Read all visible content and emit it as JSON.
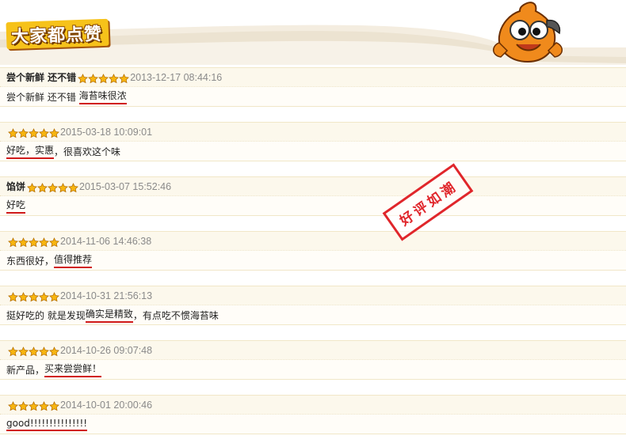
{
  "header": {
    "title": "大家都点赞",
    "mascot_icon": "orange-fish-mascot-icon"
  },
  "stamp_text": "好评如潮",
  "reviews": [
    {
      "author": "尝个新鲜 还不错",
      "stars": 5,
      "time": "2013-12-17 08:44:16",
      "text_plain": "尝个新鲜 还不错 ",
      "text_highlight": "海苔味很浓",
      "text_after": ""
    },
    {
      "author": "",
      "stars": 5,
      "time": "2015-03-18 10:09:01",
      "text_plain": "",
      "text_highlight": "好吃，实惠",
      "text_after": "，很喜欢这个味"
    },
    {
      "author": "馅饼",
      "stars": 5,
      "time": "2015-03-07 15:52:46",
      "text_plain": "",
      "text_highlight": "好吃",
      "text_after": ""
    },
    {
      "author": "",
      "stars": 5,
      "time": "2014-11-06 14:46:38",
      "text_plain": "东西很好，",
      "text_highlight": "值得推荐",
      "text_after": ""
    },
    {
      "author": "",
      "stars": 5,
      "time": "2014-10-31 21:56:13",
      "text_plain": "挺好吃的 就是发现",
      "text_highlight": "确实是精致",
      "text_after": "，有点吃不惯海苔味"
    },
    {
      "author": "",
      "stars": 5,
      "time": "2014-10-26 09:07:48",
      "text_plain": "新产品，",
      "text_highlight": "买来尝尝鲜！",
      "text_after": ""
    },
    {
      "author": "",
      "stars": 5,
      "time": "2014-10-01 20:00:46",
      "text_plain": "",
      "text_highlight": "good!!!!!!!!!!!!!!!",
      "text_after": ""
    }
  ],
  "colors": {
    "accent": "#f6c21a",
    "highlight_underline": "#d01a1a",
    "stamp": "#e0262b"
  }
}
